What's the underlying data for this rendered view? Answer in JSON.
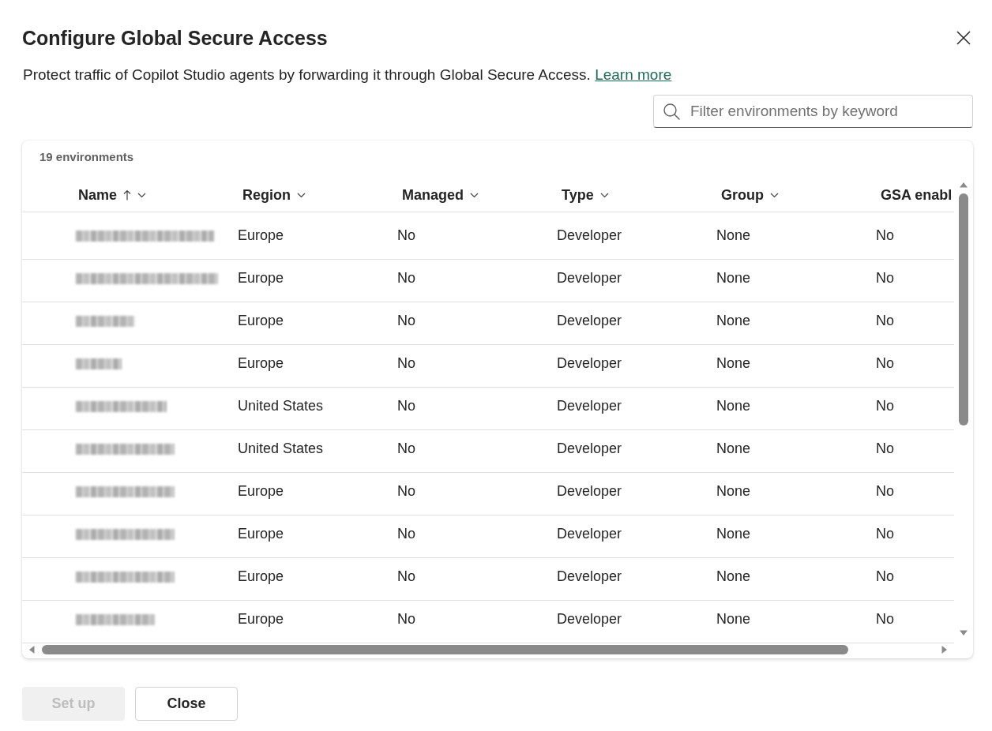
{
  "dialog": {
    "title": "Configure Global Secure Access",
    "description": "Protect traffic of Copilot Studio agents by forwarding it through Global Secure Access.",
    "link": "Learn more"
  },
  "search": {
    "placeholder": "Filter environments by keyword"
  },
  "table": {
    "count": "19 environments",
    "name_column": {
      "label": "Name",
      "sorted": true,
      "menu": true
    },
    "columns": [
      {
        "label": "Region",
        "sorted": false,
        "menu": true
      },
      {
        "label": "Managed",
        "sorted": false,
        "menu": true
      },
      {
        "label": "Type",
        "sorted": false,
        "menu": true
      },
      {
        "label": "Group",
        "sorted": false,
        "menu": true
      },
      {
        "label": "GSA enabl",
        "sorted": false,
        "menu": false
      }
    ],
    "rows": [
      {
        "cells": [
          "Europe",
          "No",
          "Developer",
          "None",
          "No"
        ]
      },
      {
        "cells": [
          "Europe",
          "No",
          "Developer",
          "None",
          "No"
        ]
      },
      {
        "cells": [
          "Europe",
          "No",
          "Developer",
          "None",
          "No"
        ]
      },
      {
        "cells": [
          "Europe",
          "No",
          "Developer",
          "None",
          "No"
        ]
      },
      {
        "cells": [
          "United States",
          "No",
          "Developer",
          "None",
          "No"
        ]
      },
      {
        "cells": [
          "United States",
          "No",
          "Developer",
          "None",
          "No"
        ]
      },
      {
        "cells": [
          "Europe",
          "No",
          "Developer",
          "None",
          "No"
        ]
      },
      {
        "cells": [
          "Europe",
          "No",
          "Developer",
          "None",
          "No"
        ]
      },
      {
        "cells": [
          "Europe",
          "No",
          "Developer",
          "None",
          "No"
        ]
      },
      {
        "cells": [
          "Europe",
          "No",
          "Developer",
          "None",
          "No"
        ]
      }
    ]
  },
  "buttons": [
    {
      "label": "Set up",
      "kind": "primary",
      "disabled": true
    },
    {
      "label": "Close",
      "kind": "secondary",
      "disabled": false
    }
  ]
}
